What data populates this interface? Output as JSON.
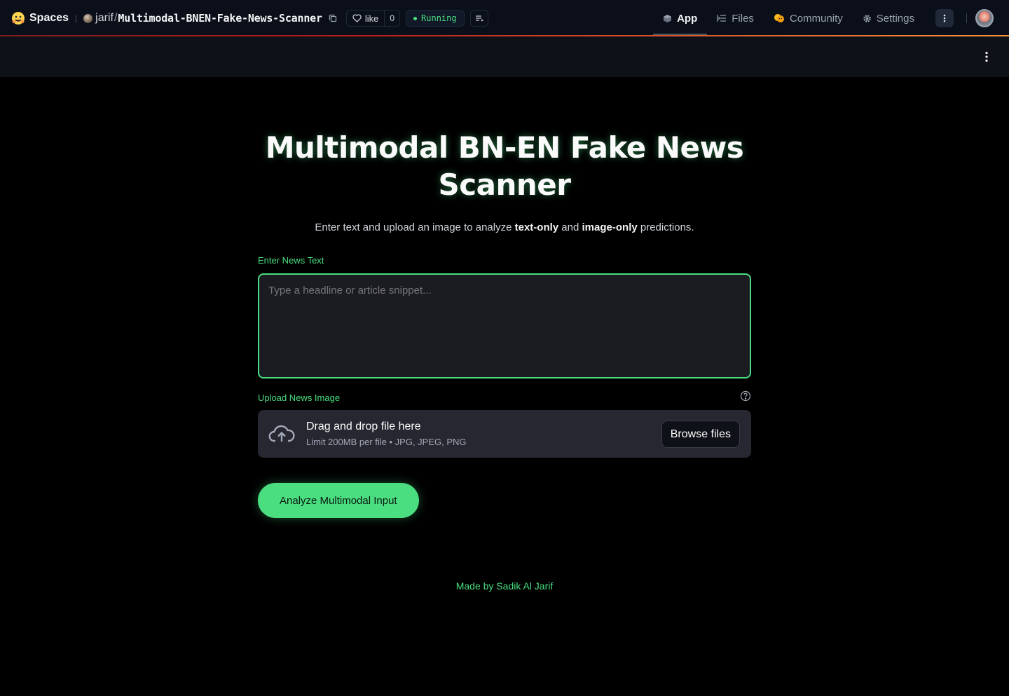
{
  "hf_bar": {
    "spaces_label": "Spaces",
    "owner": "jarif",
    "repo_name": "Multimodal-BNEN-Fake-News-Scanner",
    "like_label": "like",
    "like_count": "0",
    "status": "Running",
    "tabs": [
      {
        "label": "App",
        "icon": "cube-icon",
        "active": true
      },
      {
        "label": "Files",
        "icon": "files-icon",
        "active": false
      },
      {
        "label": "Community",
        "icon": "community-icon",
        "active": false
      },
      {
        "label": "Settings",
        "icon": "gear-icon",
        "active": false
      }
    ]
  },
  "app": {
    "title": "Multimodal BN-EN Fake News Scanner",
    "subtitle_pre": "Enter text and upload an image to analyze ",
    "subtitle_bold1": "text-only",
    "subtitle_mid": " and ",
    "subtitle_bold2": "image-only",
    "subtitle_post": " predictions.",
    "text_label": "Enter News Text",
    "text_placeholder": "Type a headline or article snippet...",
    "text_value": "",
    "upload_label": "Upload News Image",
    "dropzone_title": "Drag and drop file here",
    "dropzone_limit": "Limit 200MB per file • JPG, JPEG, PNG",
    "browse_label": "Browse files",
    "analyze_label": "Analyze Multimodal Input",
    "footer": "Made by Sadik Al Jarif"
  },
  "colors": {
    "accent": "#4ade80",
    "background": "#000000",
    "header_bg": "#0e1117",
    "input_bg": "#1b1c22",
    "dropzone_bg": "#262730"
  }
}
